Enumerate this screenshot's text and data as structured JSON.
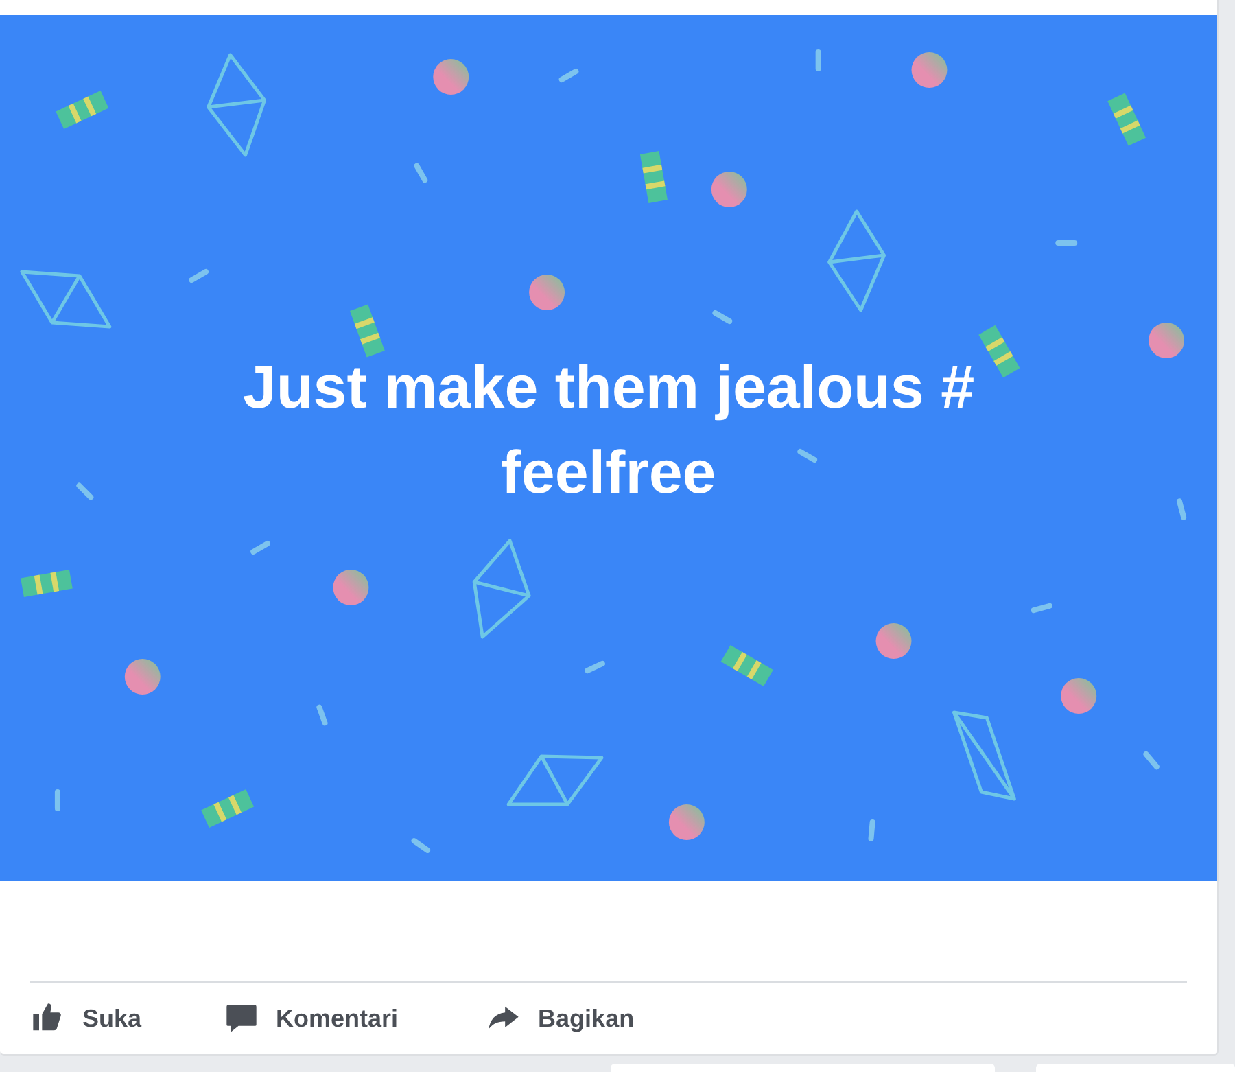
{
  "post": {
    "text": "Just make them jealous # feelfree",
    "actions": [
      {
        "kind": "like",
        "label": "Suka"
      },
      {
        "kind": "comment",
        "label": "Komentari"
      },
      {
        "kind": "share",
        "label": "Bagikan"
      }
    ]
  }
}
